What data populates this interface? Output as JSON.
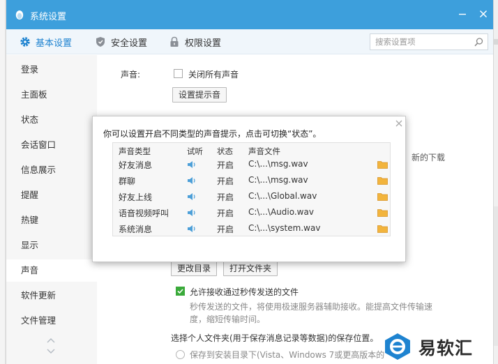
{
  "window": {
    "title": "系统设置",
    "accent_color": "#3d9fdc",
    "title_icon": "penguin-icon"
  },
  "tabs": [
    {
      "label": "基本设置",
      "icon": "gear-icon",
      "active": true
    },
    {
      "label": "安全设置",
      "icon": "shield-icon",
      "active": false
    },
    {
      "label": "权限设置",
      "icon": "lock-icon",
      "active": false
    }
  ],
  "search": {
    "placeholder": "搜索设置项",
    "icon": "search-icon"
  },
  "sidebar": {
    "items": [
      {
        "label": "登录"
      },
      {
        "label": "主面板"
      },
      {
        "label": "状态"
      },
      {
        "label": "会话窗口"
      },
      {
        "label": "信息展示"
      },
      {
        "label": "提醒"
      },
      {
        "label": "热键"
      },
      {
        "label": "显示"
      },
      {
        "label": "声音",
        "active": true
      },
      {
        "label": "软件更新"
      },
      {
        "label": "文件管理"
      }
    ]
  },
  "content": {
    "sound_label": "声音:",
    "mute_all": "关闭所有声音",
    "set_tone_button": "设置提示音",
    "peek_right_text": "新的下载",
    "change_dir_button": "更改目录",
    "open_folder_button": "打开文件夹",
    "allow_receive": "允许接收通过秒传发送的文件",
    "allow_receive_desc_1": "秒传发送的文件，将使用极速服务器辅助接收。能提高文件传输速",
    "allow_receive_desc_2": "度，缩短传输时间。",
    "choose_folder": "选择个人文件夹(用于保存消息记录等数据)的保存位置。",
    "save_to_install": "保存到安装目录下(Vista、Windows 7或更高版本的"
  },
  "dialog": {
    "instruction": "你可以设置开启不同类型的声音提示，点击可切换“状态”。",
    "columns": [
      "声音类型",
      "试听",
      "状态",
      "声音文件"
    ],
    "rows": [
      {
        "type": "好友消息",
        "status": "开启",
        "file": "C:\\...\\msg.wav"
      },
      {
        "type": "群聊",
        "status": "开启",
        "file": "C:\\...\\msg.wav"
      },
      {
        "type": "好友上线",
        "status": "开启",
        "file": "C:\\...\\Global.wav"
      },
      {
        "type": "语音视频呼叫",
        "status": "开启",
        "file": "C:\\...\\Audio.wav"
      },
      {
        "type": "系统消息",
        "status": "开启",
        "file": "C:\\...\\system.wav"
      }
    ]
  },
  "watermark": {
    "text": "易软汇"
  }
}
